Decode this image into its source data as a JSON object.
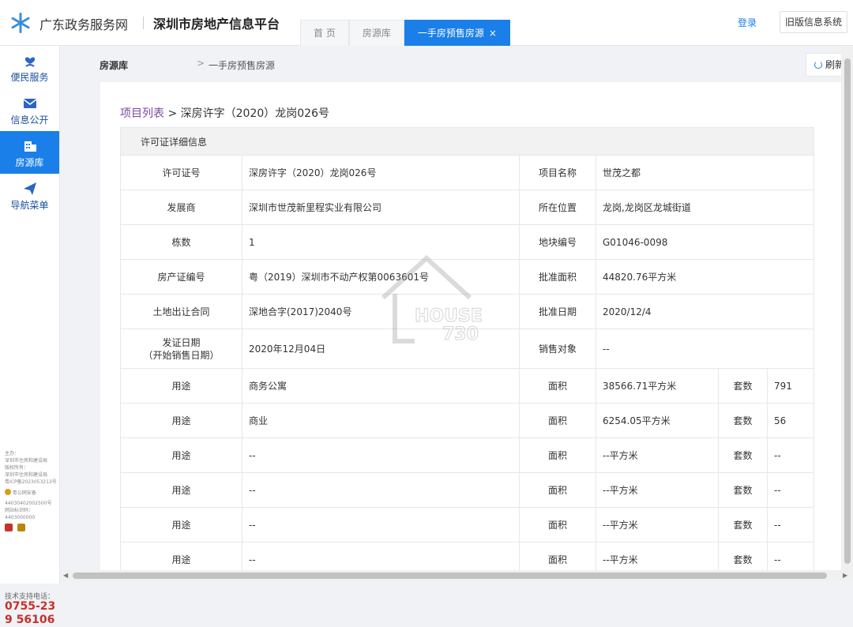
{
  "header": {
    "gov_title": "广东政务服务网",
    "site_title": "深圳市房地产信息平台",
    "tabs": [
      {
        "label": "首 页"
      },
      {
        "label": "房源库"
      },
      {
        "label": "一手房预售房源"
      }
    ],
    "tab_close": "×",
    "login": "登录",
    "old_system": "旧版信息系统"
  },
  "sidebar": {
    "items": [
      {
        "label": "便民服务",
        "icon": "heart-hand-icon"
      },
      {
        "label": "信息公开",
        "icon": "envelope-icon"
      },
      {
        "label": "房源库",
        "icon": "building-icon"
      },
      {
        "label": "导航菜单",
        "icon": "paper-plane-icon"
      }
    ],
    "footer": {
      "lines": [
        "主办：",
        "深圳市住房和建设局",
        "版权所有：",
        "深圳市住房和建设局",
        "粤ICP备2023053213号"
      ],
      "police": "粤公网安备",
      "police_no": "44030402002500号",
      "site_id_label": "网站标识码：",
      "site_id": "4403000000",
      "support_label": "技术支持电话：",
      "support_phone": "0755-239 56106"
    }
  },
  "breadcrumb": {
    "root": "房源库",
    "sep": ">",
    "current": "一手房预售房源"
  },
  "refresh_label": "刷新",
  "project_crumb": {
    "link": "项目列表",
    "sep": " > ",
    "current": "深房许字（2020）龙岗026号"
  },
  "detail": {
    "section_title": "许可证详细信息",
    "rows": [
      {
        "l1": "许可证号",
        "v1": "深房许字（2020）龙岗026号",
        "l2": "项目名称",
        "v2": "世茂之都"
      },
      {
        "l1": "发展商",
        "v1": "深圳市世茂新里程实业有限公司",
        "l2": "所在位置",
        "v2": "龙岗,龙岗区龙城街道"
      },
      {
        "l1": "栋数",
        "v1": "1",
        "l2": "地块编号",
        "v2": "G01046-0098"
      },
      {
        "l1": "房产证编号",
        "v1": "粤（2019）深圳市不动产权第0063601号",
        "l2": "批准面积",
        "v2": "44820.76平方米"
      },
      {
        "l1": "土地出让合同",
        "v1": "深地合字(2017)2040号",
        "l2": "批准日期",
        "v2": "2020/12/4"
      }
    ],
    "issue_row": {
      "l1a": "发证日期",
      "l1b": "（开始销售日期）",
      "v1": "2020年12月04日",
      "l2": "销售对象",
      "v2": "--"
    },
    "usage_rows": [
      {
        "usage_label": "用途",
        "usage": "商务公寓",
        "area_label": "面积",
        "area": "38566.71平方米",
        "units_label": "套数",
        "units": "791"
      },
      {
        "usage_label": "用途",
        "usage": "商业",
        "area_label": "面积",
        "area": "6254.05平方米",
        "units_label": "套数",
        "units": "56"
      },
      {
        "usage_label": "用途",
        "usage": "--",
        "area_label": "面积",
        "area": "--平方米",
        "units_label": "套数",
        "units": "--"
      },
      {
        "usage_label": "用途",
        "usage": "--",
        "area_label": "面积",
        "area": "--平方米",
        "units_label": "套数",
        "units": "--"
      },
      {
        "usage_label": "用途",
        "usage": "--",
        "area_label": "面积",
        "area": "--平方米",
        "units_label": "套数",
        "units": "--"
      },
      {
        "usage_label": "用途",
        "usage": "--",
        "area_label": "面积",
        "area": "--平方米",
        "units_label": "套数",
        "units": "--"
      }
    ]
  },
  "watermark": {
    "line1": "HOUSE",
    "line2": "730"
  },
  "colors": {
    "accent": "#1a7fe8",
    "link_purple": "#7a4a9c",
    "phone_red": "#c8302c"
  }
}
